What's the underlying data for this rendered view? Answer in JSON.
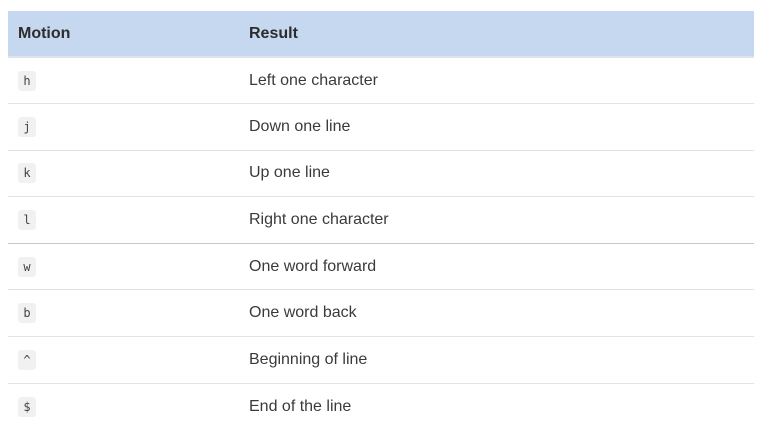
{
  "table": {
    "headers": {
      "motion": "Motion",
      "result": "Result"
    },
    "rows": [
      {
        "motion": "h",
        "result": "Left one character"
      },
      {
        "motion": "j",
        "result": "Down one line"
      },
      {
        "motion": "k",
        "result": "Up one line"
      },
      {
        "motion": "l",
        "result": "Right one character"
      },
      {
        "motion": "w",
        "result": "One word forward"
      },
      {
        "motion": "b",
        "result": "One word back"
      },
      {
        "motion": "^",
        "result": "Beginning of line"
      },
      {
        "motion": "$",
        "result": "End of the line"
      }
    ]
  },
  "colors": {
    "header_background": "#c5d8ef",
    "code_background": "#f1f1f1",
    "row_divider": "#e3e3e3"
  }
}
